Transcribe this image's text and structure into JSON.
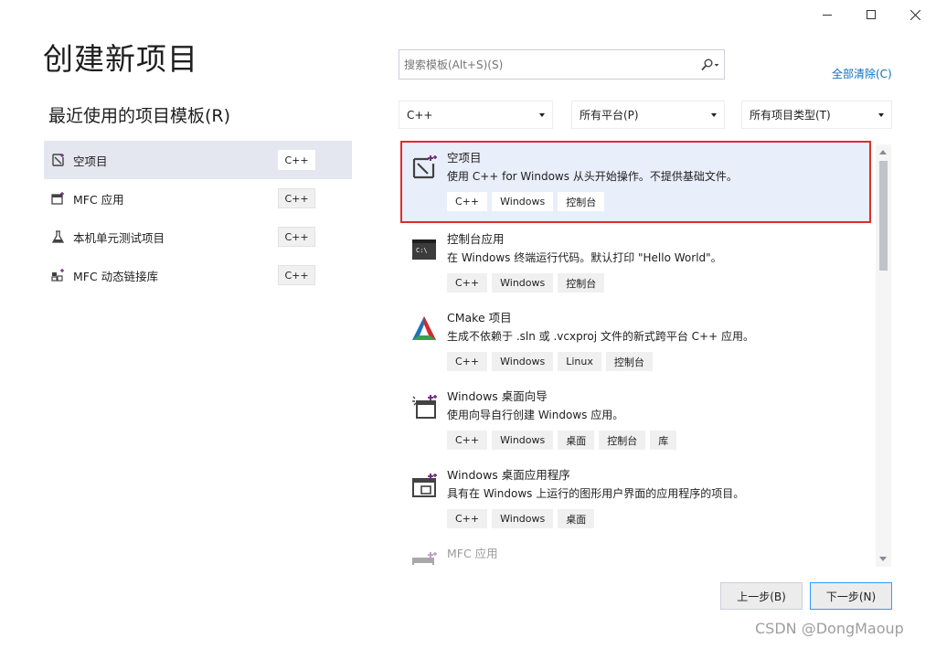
{
  "window": {
    "minimize": "–",
    "maximize": "□",
    "close": "✕"
  },
  "title": "创建新项目",
  "recent": {
    "heading": "最近使用的项目模板(R)",
    "items": [
      {
        "label": "空项目",
        "tag": "C++",
        "icon": "empty-project-icon"
      },
      {
        "label": "MFC 应用",
        "tag": "C++",
        "icon": "mfc-app-icon"
      },
      {
        "label": "本机单元测试项目",
        "tag": "C++",
        "icon": "unit-test-icon"
      },
      {
        "label": "MFC 动态链接库",
        "tag": "C++",
        "icon": "mfc-dll-icon"
      }
    ]
  },
  "search": {
    "placeholder": "搜索模板(Alt+S)(S)"
  },
  "clear_all": "全部清除(C)",
  "filters": {
    "language": "C++",
    "platform": "所有平台(P)",
    "project_type": "所有项目类型(T)"
  },
  "templates": [
    {
      "title": "空项目",
      "desc": "使用 C++ for Windows 从头开始操作。不提供基础文件。",
      "tags": [
        "C++",
        "Windows",
        "控制台"
      ],
      "icon": "empty-project-icon"
    },
    {
      "title": "控制台应用",
      "desc": "在 Windows 终端运行代码。默认打印 \"Hello World\"。",
      "tags": [
        "C++",
        "Windows",
        "控制台"
      ],
      "icon": "console-app-icon"
    },
    {
      "title": "CMake 项目",
      "desc": "生成不依赖于 .sln 或 .vcxproj 文件的新式跨平台 C++ 应用。",
      "tags": [
        "C++",
        "Windows",
        "Linux",
        "控制台"
      ],
      "icon": "cmake-icon"
    },
    {
      "title": "Windows 桌面向导",
      "desc": "使用向导自行创建 Windows 应用。",
      "tags": [
        "C++",
        "Windows",
        "桌面",
        "控制台",
        "库"
      ],
      "icon": "desktop-wizard-icon"
    },
    {
      "title": "Windows 桌面应用程序",
      "desc": "具有在 Windows 上运行的图形用户界面的应用程序的项目。",
      "tags": [
        "C++",
        "Windows",
        "桌面"
      ],
      "icon": "desktop-app-icon"
    },
    {
      "title": "MFC 应用",
      "desc": "",
      "tags": [],
      "icon": "mfc-app-icon"
    }
  ],
  "buttons": {
    "prev": "上一步(B)",
    "next": "下一步(N)"
  },
  "watermark": "CSDN @DongMaoup",
  "colors": {
    "accent": "#3399ff",
    "selection_border": "#e12b2b",
    "link": "#0e70c0"
  }
}
